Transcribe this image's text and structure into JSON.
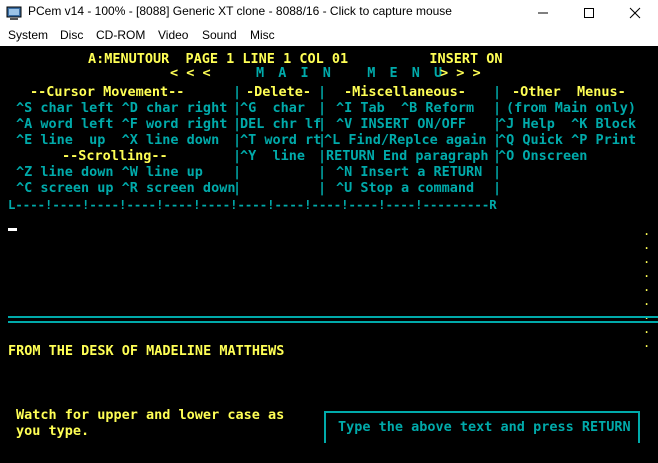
{
  "window": {
    "title": "PCem v14 - 100% - [8088] Generic XT clone - 8088/16 - Click to capture mouse"
  },
  "menubar": {
    "items": [
      "System",
      "Disc",
      "CD-ROM",
      "Video",
      "Sound",
      "Misc"
    ]
  },
  "status": {
    "line": "A:MENUTOUR  PAGE 1 LINE 1 COL 01          INSERT ON"
  },
  "main_menu": {
    "left_arrows": "< < <",
    "title": "M A I N   M E N U",
    "right_arrows": "> > >"
  },
  "help": {
    "cursor_heading": "--Cursor Movement--",
    "cursor_rows": [
      "^S char left ^D char right",
      "^A word left ^F word right",
      "^E line  up  ^X line down"
    ],
    "scroll_heading": "--Scrolling--",
    "scroll_rows": [
      "^Z line down ^W line up",
      "^C screen up ^R screen down"
    ],
    "delete_heading": "-Delete-",
    "delete_rows": [
      "^G  char",
      "DEL chr lf",
      "^T word rt",
      "^Y  line"
    ],
    "misc_heading": "-Miscellaneous-",
    "misc_rows": [
      "^I Tab  ^B Reform",
      "^V INSERT ON/OFF",
      "^L Find/Replce again",
      "RETURN End paragraph",
      "^N Insert a RETURN",
      "^U Stop a command"
    ],
    "other_heading": "-Other  Menus-",
    "other_rows": [
      "(from Main only)",
      "^J Help  ^K Block",
      "^Q Quick ^P Print",
      "^O Onscreen"
    ]
  },
  "ruler": {
    "text": "L----!----!----!----!----!----!----!----!----!----!----!---------R"
  },
  "document": {
    "line1": "FROM THE DESK OF MADELINE MATTHEWS"
  },
  "instructions": {
    "line1": "Watch for upper and lower case as",
    "line2": "you type."
  },
  "prompt": {
    "text": "Type the above text and press RETURN"
  },
  "colors": {
    "yellow": "#ffff55",
    "cyan": "#00aaaa",
    "background": "#000000"
  }
}
